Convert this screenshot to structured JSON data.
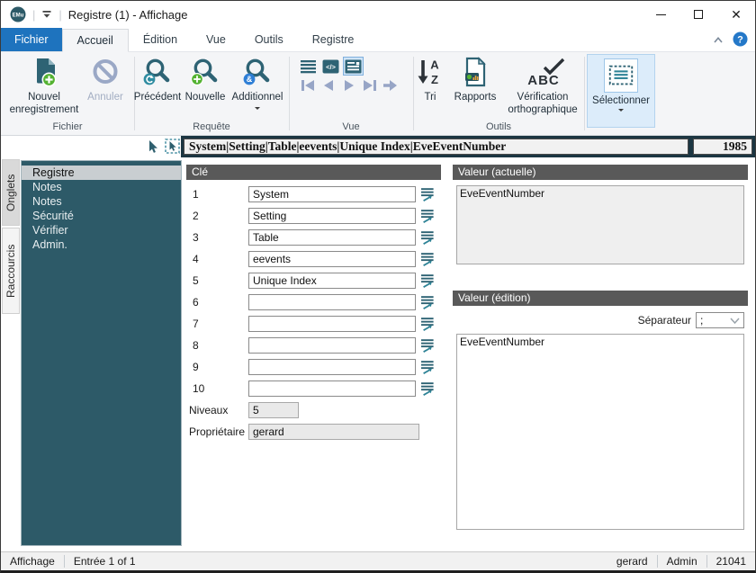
{
  "titlebar": {
    "logo": "EMu",
    "title": "Registre (1) - Affichage"
  },
  "tabs": {
    "fichier": "Fichier",
    "accueil": "Accueil",
    "edition": "Édition",
    "vue": "Vue",
    "outils": "Outils",
    "registre": "Registre"
  },
  "ribbon": {
    "fichier_group": {
      "label": "Fichier",
      "new_record": "Nouvel enregistrement",
      "cancel": "Annuler"
    },
    "requete_group": {
      "label": "Requête",
      "previous": "Précédent",
      "new": "Nouvelle",
      "additional": "Additionnel"
    },
    "vue_group": {
      "label": "Vue"
    },
    "outils_group": {
      "label": "Outils",
      "sort": "Tri",
      "reports": "Rapports",
      "spellcheck": "Vérification orthographique"
    },
    "select_button": "Sélectionner"
  },
  "icons": {
    "sort_a": "A",
    "sort_z": "Z",
    "spell": "ABC",
    "code": "</>",
    "ampersand": "&",
    "help": "?"
  },
  "breadcrumb": {
    "path": "System|Setting|Table|eevents|Unique Index|EveEventNumber",
    "record_id": "1985"
  },
  "sidebar": {
    "tab_onglets": "Onglets",
    "tab_raccourcis": "Raccourcis",
    "items": [
      {
        "label": "Registre",
        "selected": true
      },
      {
        "label": "Notes"
      },
      {
        "label": "Notes"
      },
      {
        "label": "Sécurité"
      },
      {
        "label": "Vérifier"
      },
      {
        "label": "Admin."
      }
    ]
  },
  "key_panel": {
    "header": "Clé",
    "rows": [
      {
        "num": "1",
        "value": "System"
      },
      {
        "num": "2",
        "value": "Setting"
      },
      {
        "num": "3",
        "value": "Table"
      },
      {
        "num": "4",
        "value": "eevents"
      },
      {
        "num": "5",
        "value": "Unique Index"
      },
      {
        "num": "6",
        "value": ""
      },
      {
        "num": "7",
        "value": ""
      },
      {
        "num": "8",
        "value": ""
      },
      {
        "num": "9",
        "value": ""
      },
      {
        "num": "10",
        "value": ""
      }
    ],
    "levels_label": "Niveaux",
    "levels_value": "5",
    "owner_label": "Propriétaire",
    "owner_value": "gerard"
  },
  "value_current": {
    "header": "Valeur (actuelle)",
    "text": "EveEventNumber"
  },
  "value_edit": {
    "header": "Valeur (édition)",
    "separator_label": "Séparateur",
    "separator_value": ";",
    "text": "EveEventNumber"
  },
  "statusbar": {
    "mode": "Affichage",
    "record_count": "Entrée 1 of 1",
    "user": "gerard",
    "role": "Admin",
    "session": "21041"
  },
  "colors": {
    "accent_blue": "#1e73be",
    "teal_dark": "#2d5a68",
    "teal_icon": "#2e6374",
    "header_gray": "#595959",
    "green": "#54b232",
    "disabled_gray_blue": "#97a5c6",
    "band_dark": "#1c3642",
    "select_highlight": "#dcecfa"
  }
}
